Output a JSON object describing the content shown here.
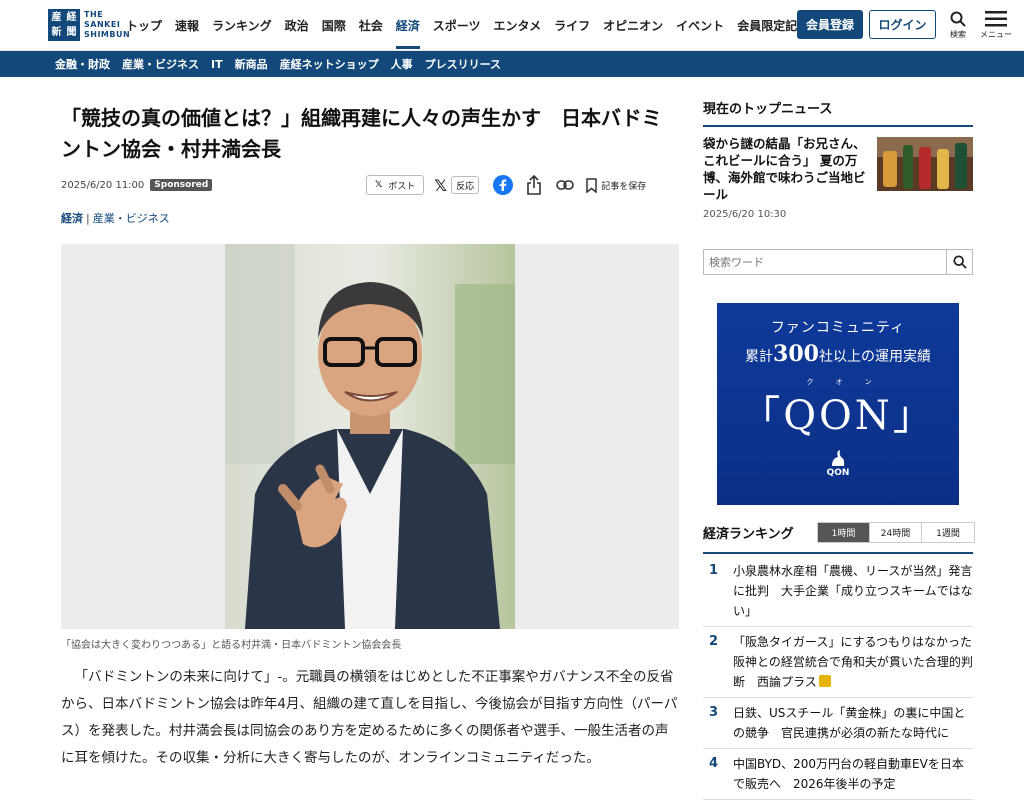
{
  "header": {
    "logo_mark": [
      "産",
      "経",
      "新",
      "聞"
    ],
    "logo_text_lines": [
      "THE",
      "SANKEI",
      "SHIMBUN"
    ],
    "nav": [
      "トップ",
      "速報",
      "ランキング",
      "政治",
      "国際",
      "社会",
      "経済",
      "スポーツ",
      "エンタメ",
      "ライフ",
      "オピニオン",
      "イベント",
      "会員限定記事"
    ],
    "active_nav": "経済",
    "register_label": "会員登録",
    "login_label": "ログイン",
    "search_label": "検索",
    "menu_label": "メニュー"
  },
  "subnav": [
    "金融・財政",
    "産業・ビジネス",
    "IT",
    "新商品",
    "産経ネットショップ",
    "人事",
    "プレスリリース"
  ],
  "article": {
    "title": "「競技の真の価値とは？」組織再建に人々の声生かす　日本バドミントン協会・村井満会長",
    "date": "2025/6/20 11:00",
    "sponsored": "Sponsored",
    "share_post": "ポスト",
    "share_reaction": "反応",
    "save_label": "記事を保存",
    "category_main": "経済",
    "category_sub": "産業・ビジネス",
    "caption": "「協会は大きく変わりつつある」と語る村井満・日本バドミントン協会会長",
    "body": "「バドミントンの未来に向けて」-。元職員の横領をはじめとした不正事案やガバナンス不全の反省から、日本バドミントン協会は昨年4月、組織の建て直しを目指し、今後協会が目指す方向性（パーパス）を発表した。村井満会長は同協会のあり方を定めるために多くの関係者や選手、一般生活者の声に耳を傾けた。その収集・分析に大きく寄与したのが、オンラインコミュニティだった。"
  },
  "sidebar": {
    "top_news_heading": "現在のトップニュース",
    "top_news_title": "袋から謎の結晶「お兄さん、これビールに合う」 夏の万博、海外館で味わうご当地ビール",
    "top_news_date": "2025/6/20 10:30",
    "search_placeholder": "検索ワード",
    "ad": {
      "line1": "ファンコミュニティ",
      "line2_pre": "累計",
      "line2_num": "300",
      "line2_post": "社以上の運用実績",
      "ruby": "クオン",
      "brand": "「QON」",
      "brand_small": "QON"
    },
    "ranking_heading": "経済ランキング",
    "ranking_tabs": [
      "1時間",
      "24時間",
      "1週間"
    ],
    "ranking_active_tab": "1時間",
    "ranking": [
      {
        "num": "1",
        "text": "小泉農林水産相「農機、リースが当然」発言に批判　大手企業「成り立つスキームではない」"
      },
      {
        "num": "2",
        "text": "「阪急タイガース」にするつもりはなかった　阪神との経営統合で角和夫が貫いた合理的判断　西論プラス"
      },
      {
        "num": "3",
        "text": "日鉄、USスチール「黄金株」の裏に中国との競争　官民連携が必須の新たな時代に"
      },
      {
        "num": "4",
        "text": "中国BYD、200万円台の軽自動車EVを日本で販売へ　2026年後半の予定"
      }
    ]
  },
  "colors": {
    "brand": "#13497a",
    "ad_bg": "#0f3a9a",
    "badge": "#555555"
  }
}
